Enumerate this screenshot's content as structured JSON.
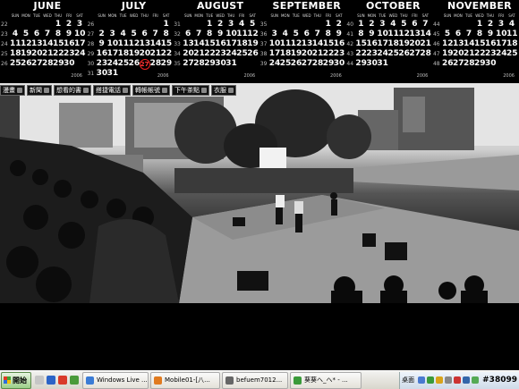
{
  "calendar": {
    "dow_labels": [
      "SUN",
      "MON",
      "TUE",
      "WED",
      "THU",
      "FRI",
      "SAT"
    ],
    "months": [
      {
        "name": "JUNE",
        "year": "2006",
        "weeks": [
          {
            "wk": "22",
            "days": [
              "",
              "",
              "",
              "",
              "1",
              "2",
              "3"
            ]
          },
          {
            "wk": "23",
            "days": [
              "4",
              "5",
              "6",
              "7",
              "8",
              "9",
              "10"
            ]
          },
          {
            "wk": "24",
            "days": [
              "11",
              "12",
              "13",
              "14",
              "15",
              "16",
              "17"
            ]
          },
          {
            "wk": "25",
            "days": [
              "18",
              "19",
              "20",
              "21",
              "22",
              "23",
              "24"
            ]
          },
          {
            "wk": "26",
            "days": [
              "25",
              "26",
              "27",
              "28",
              "29",
              "30",
              ""
            ]
          }
        ]
      },
      {
        "name": "JULY",
        "year": "2006",
        "weeks": [
          {
            "wk": "26",
            "days": [
              "",
              "",
              "",
              "",
              "",
              "",
              "1"
            ]
          },
          {
            "wk": "27",
            "days": [
              "2",
              "3",
              "4",
              "5",
              "6",
              "7",
              "8"
            ]
          },
          {
            "wk": "28",
            "days": [
              "9",
              "10",
              "11",
              "12",
              "13",
              "14",
              "15"
            ]
          },
          {
            "wk": "29",
            "days": [
              "16",
              "17",
              "18",
              "19",
              "20",
              "21",
              "22"
            ]
          },
          {
            "wk": "30",
            "days": [
              "23",
              "24",
              "25",
              "26",
              "27",
              "28",
              "29"
            ]
          },
          {
            "wk": "31",
            "days": [
              "30",
              "31",
              "",
              "",
              "",
              "",
              ""
            ]
          }
        ]
      },
      {
        "name": "AUGUST",
        "year": "2006",
        "weeks": [
          {
            "wk": "31",
            "days": [
              "",
              "",
              "1",
              "2",
              "3",
              "4",
              "5"
            ]
          },
          {
            "wk": "32",
            "days": [
              "6",
              "7",
              "8",
              "9",
              "10",
              "11",
              "12"
            ]
          },
          {
            "wk": "33",
            "days": [
              "13",
              "14",
              "15",
              "16",
              "17",
              "18",
              "19"
            ]
          },
          {
            "wk": "34",
            "days": [
              "20",
              "21",
              "22",
              "23",
              "24",
              "25",
              "26"
            ]
          },
          {
            "wk": "35",
            "days": [
              "27",
              "28",
              "29",
              "30",
              "31",
              "",
              ""
            ]
          }
        ]
      },
      {
        "name": "SEPTEMBER",
        "year": "2006",
        "weeks": [
          {
            "wk": "35",
            "days": [
              "",
              "",
              "",
              "",
              "",
              "1",
              "2"
            ]
          },
          {
            "wk": "36",
            "days": [
              "3",
              "4",
              "5",
              "6",
              "7",
              "8",
              "9"
            ]
          },
          {
            "wk": "37",
            "days": [
              "10",
              "11",
              "12",
              "13",
              "14",
              "15",
              "16"
            ]
          },
          {
            "wk": "38",
            "days": [
              "17",
              "18",
              "19",
              "20",
              "21",
              "22",
              "23"
            ]
          },
          {
            "wk": "39",
            "days": [
              "24",
              "25",
              "26",
              "27",
              "28",
              "29",
              "30"
            ]
          }
        ]
      },
      {
        "name": "OCTOBER",
        "year": "2006",
        "weeks": [
          {
            "wk": "40",
            "days": [
              "1",
              "2",
              "3",
              "4",
              "5",
              "6",
              "7"
            ]
          },
          {
            "wk": "41",
            "days": [
              "8",
              "9",
              "10",
              "11",
              "12",
              "13",
              "14"
            ]
          },
          {
            "wk": "42",
            "days": [
              "15",
              "16",
              "17",
              "18",
              "19",
              "20",
              "21"
            ]
          },
          {
            "wk": "43",
            "days": [
              "22",
              "23",
              "24",
              "25",
              "26",
              "27",
              "28"
            ]
          },
          {
            "wk": "44",
            "days": [
              "29",
              "30",
              "31",
              "",
              "",
              "",
              ""
            ]
          }
        ]
      },
      {
        "name": "NOVEMBER",
        "year": "2006",
        "weeks": [
          {
            "wk": "44",
            "days": [
              "",
              "",
              "",
              "1",
              "2",
              "3",
              "4"
            ]
          },
          {
            "wk": "45",
            "days": [
              "5",
              "6",
              "7",
              "8",
              "9",
              "10",
              "11"
            ]
          },
          {
            "wk": "46",
            "days": [
              "12",
              "13",
              "14",
              "15",
              "16",
              "17",
              "18"
            ]
          },
          {
            "wk": "47",
            "days": [
              "19",
              "20",
              "21",
              "22",
              "23",
              "24",
              "25"
            ]
          },
          {
            "wk": "48",
            "days": [
              "26",
              "27",
              "28",
              "29",
              "30",
              "",
              ""
            ]
          }
        ]
      }
    ]
  },
  "quickbar": {
    "items": [
      "漫畫",
      "新聞",
      "想看的書",
      "搭捷電話",
      "轉帳帳號",
      "下午茶點",
      "衣服"
    ]
  },
  "taskbar": {
    "start_label": "開始",
    "tasks": [
      {
        "label": "Windows Live ...",
        "color": "#3a7bd5"
      },
      {
        "label": "Mobile01-[八...",
        "color": "#e07a1f"
      },
      {
        "label": "befuem7012...",
        "color": "#666"
      },
      {
        "label": "葵葵へ_へ* - ...",
        "color": "#3a9a3a"
      }
    ],
    "tray_label": "桌面",
    "clock": "#38099"
  }
}
